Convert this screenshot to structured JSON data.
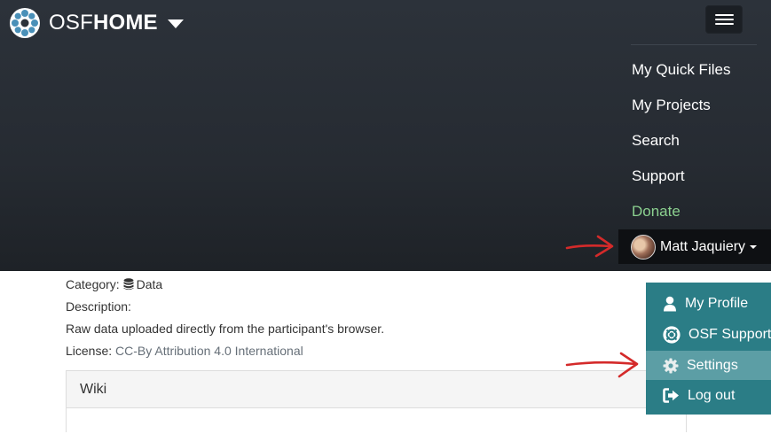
{
  "navbar": {
    "brand": {
      "osf": "OSF",
      "home": "HOME"
    },
    "menu_items": [
      {
        "label": "My Quick Files"
      },
      {
        "label": "My Projects"
      },
      {
        "label": "Search"
      },
      {
        "label": "Support"
      },
      {
        "label": "Donate"
      }
    ],
    "user": {
      "name": "Matt Jaquiery"
    }
  },
  "user_dropdown": {
    "items": [
      {
        "label": "My Profile",
        "icon": "user-icon"
      },
      {
        "label": "OSF Support",
        "icon": "life-ring-icon"
      },
      {
        "label": "Settings",
        "icon": "gear-icon",
        "active": true
      },
      {
        "label": "Log out",
        "icon": "sign-out-icon"
      }
    ]
  },
  "details": {
    "category_label": "Category:",
    "category_value": "Data",
    "description_label": "Description:",
    "description_text": "Raw data uploaded directly from the participant's browser.",
    "license_label": "License:",
    "license_value": "CC-By Attribution 4.0 International"
  },
  "wiki": {
    "title": "Wiki"
  },
  "colors": {
    "navbar_bg": "#2c323a",
    "dropdown_bg": "#2b7d86",
    "dropdown_active": "#5c9ea5",
    "donate": "#8bd08f",
    "annotation_arrow": "#d42a2a"
  }
}
